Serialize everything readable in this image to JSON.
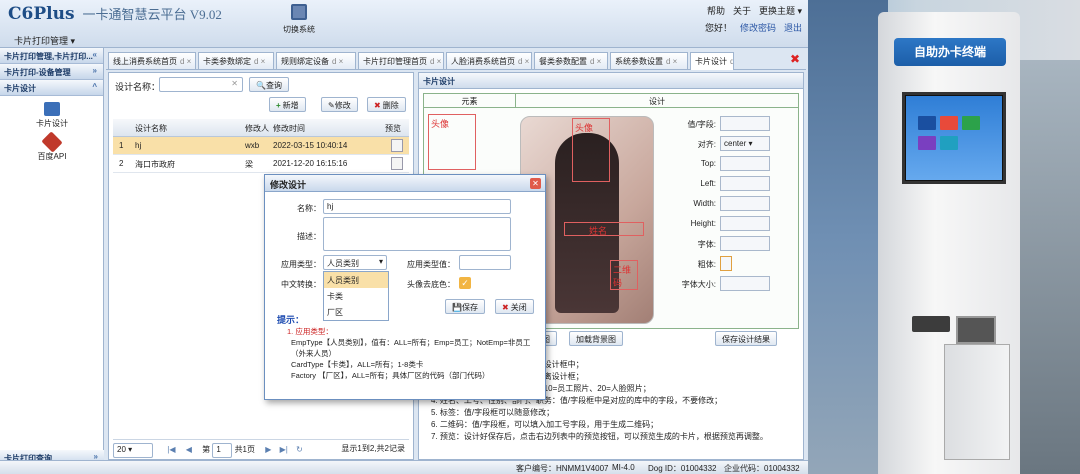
{
  "header": {
    "brand": "C6Plus",
    "subtitle": "一卡通智慧云平台 V9.02",
    "module_menu": "卡片打印管理 ▾",
    "system_switch": "切换系统",
    "help": "帮助",
    "about": "关于",
    "theme": "更换主题 ▾",
    "greeting": "您好！",
    "change_password": "修改密码",
    "logout": "退出"
  },
  "sidebar": {
    "sections": [
      {
        "label": "卡片打印管理,卡片打印...",
        "chevron": "«"
      },
      {
        "label": "卡片打印-设备管理",
        "chevron": "»"
      },
      {
        "label": "卡片设计",
        "chevron": "^"
      }
    ],
    "items": [
      {
        "label": "卡片设计",
        "icon": "trash-icon"
      },
      {
        "label": "百度API",
        "icon": "tools-icon"
      }
    ],
    "bottom": {
      "label": "卡片打印查询",
      "chevron": "»"
    }
  },
  "tabs": [
    "线上消费系统首页",
    "卡类参数绑定",
    "规则绑定设备",
    "卡片打印管理首页",
    "人脸消费系统首页",
    "餐类参数配置",
    "系统参数设置",
    "卡片设计"
  ],
  "tab_close": "d ×",
  "left": {
    "search_label": "设计名称：",
    "search_btn": "查询",
    "add_btn": "新增",
    "edit_btn": "修改",
    "delete_btn": "删除",
    "columns": [
      "设计名称",
      "修改人",
      "修改时间",
      "预览"
    ],
    "rows": [
      {
        "idx": "1",
        "name": "hj",
        "user": "wxb",
        "time": "2022-03-15 10:40:14"
      },
      {
        "idx": "2",
        "name": "海口市政府",
        "user": "梁",
        "time": "2021-12-20 16:15:16"
      }
    ],
    "pager": {
      "size": "20 ▾",
      "page_label": "第",
      "page": "1",
      "total_pages": "共1页",
      "summary": "显示1到2,共2记录"
    }
  },
  "right": {
    "title": "卡片设计",
    "elements_header": "元素",
    "design_header": "设计",
    "label_avatar": "头像",
    "label_avatar2": "头像",
    "label_name": "姓名",
    "label_qr": "二维码",
    "props": [
      {
        "label": "值/字段:",
        "value": ""
      },
      {
        "label": "对齐:",
        "value": "center ▾"
      },
      {
        "label": "Top:",
        "value": ""
      },
      {
        "label": "Left:",
        "value": ""
      },
      {
        "label": "Width:",
        "value": ""
      },
      {
        "label": "Height:",
        "value": ""
      },
      {
        "label": "字体:",
        "value": ""
      },
      {
        "label": "粗体:",
        "value": ""
      },
      {
        "label": "字体大小:",
        "value": ""
      }
    ],
    "btn_bg": "景图",
    "btn_load_bg": "加载背景图",
    "btn_save": "保存设计结果",
    "tips": [
      "...在设计框中；",
      "...隔离设计框；",
      "...入10=员工照片、20=人脸照片；",
      "4. 姓名、工号、性别、部门、职务：值/字段框中是对应的库中的字段，不要修改；",
      "5. 标签：值/字段框可以随意修改；",
      "6. 二维码：值/字段框，可以填入加工号字段，用于生成二维码；",
      "7. 预览：设计好保存后，点击右边列表中的预览按钮，可以预览生成的卡片，根据预览再调整。"
    ]
  },
  "dialog": {
    "title": "修改设计",
    "name_label": "名称：",
    "name_value": "hj",
    "desc_label": "描述：",
    "type_label": "应用类型：",
    "type_value": "人员类别",
    "type_value_label": "应用类型值：",
    "convert_label": "中文转换：",
    "bg_label": "头像去底色：",
    "options": [
      "人员类别",
      "卡类",
      "厂区"
    ],
    "save_btn": "保存",
    "close_btn": "关闭",
    "tip_title": "提示：",
    "tips": [
      "1. 应用类型：",
      "EmpType【人员类别】，值有：ALL=所有；Emp=员工；NotEmp=非员工（外来人员）",
      "CardType【卡类】，ALL=所有；1-8类卡",
      "Factory 【厂区】，ALL=所有；具体厂区的代码（部门代码）"
    ]
  },
  "status": {
    "customer": "客户编号：HNMM1V4007",
    "ver": "MI-4.0",
    "dog": "Dog ID：01004332",
    "company": "企业代码：01004332"
  },
  "kiosk": {
    "title": "自助办卡终端"
  }
}
